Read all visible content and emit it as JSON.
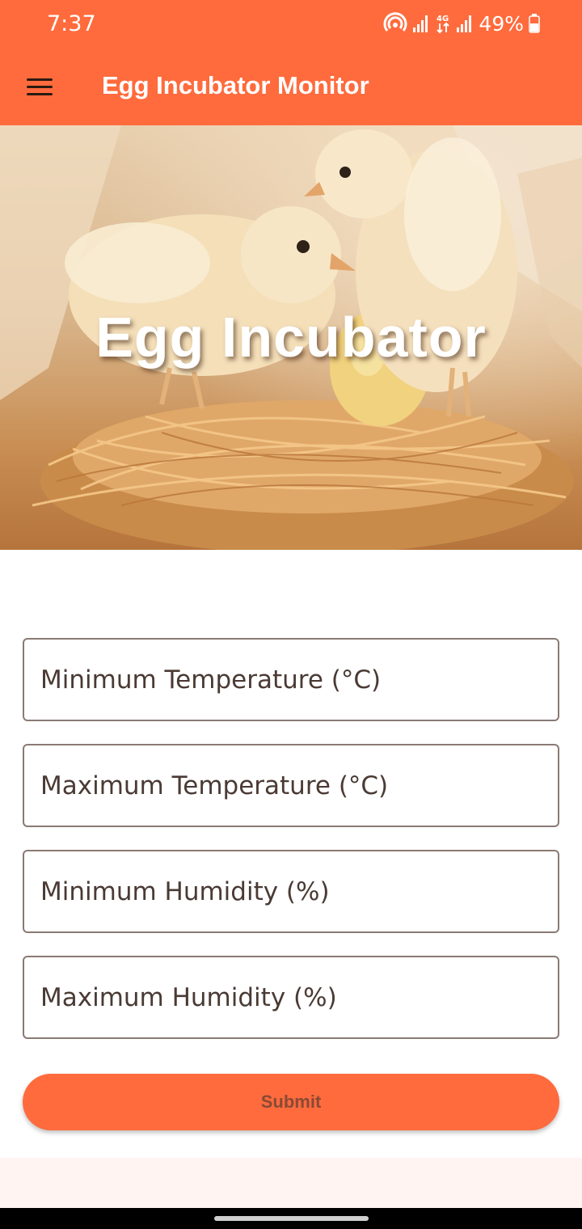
{
  "status_bar": {
    "time": "7:37",
    "battery": "49%",
    "icons": [
      "hotspot-icon",
      "signal-icon",
      "4g-data-icon",
      "signal-icon",
      "battery-icon"
    ]
  },
  "app_bar": {
    "title": "Egg Incubator Monitor",
    "menu_icon": "hamburger-menu-icon",
    "color": "#ff6b3d"
  },
  "hero": {
    "title": "Egg Incubator",
    "image": "chicks-in-straw-nest"
  },
  "form": {
    "fields": [
      {
        "placeholder": "Minimum Temperature (°C)",
        "value": ""
      },
      {
        "placeholder": "Maximum Temperature (°C)",
        "value": ""
      },
      {
        "placeholder": "Minimum Humidity (%)",
        "value": ""
      },
      {
        "placeholder": "Maximum Humidity (%)",
        "value": ""
      }
    ],
    "submit_label": "Submit"
  }
}
